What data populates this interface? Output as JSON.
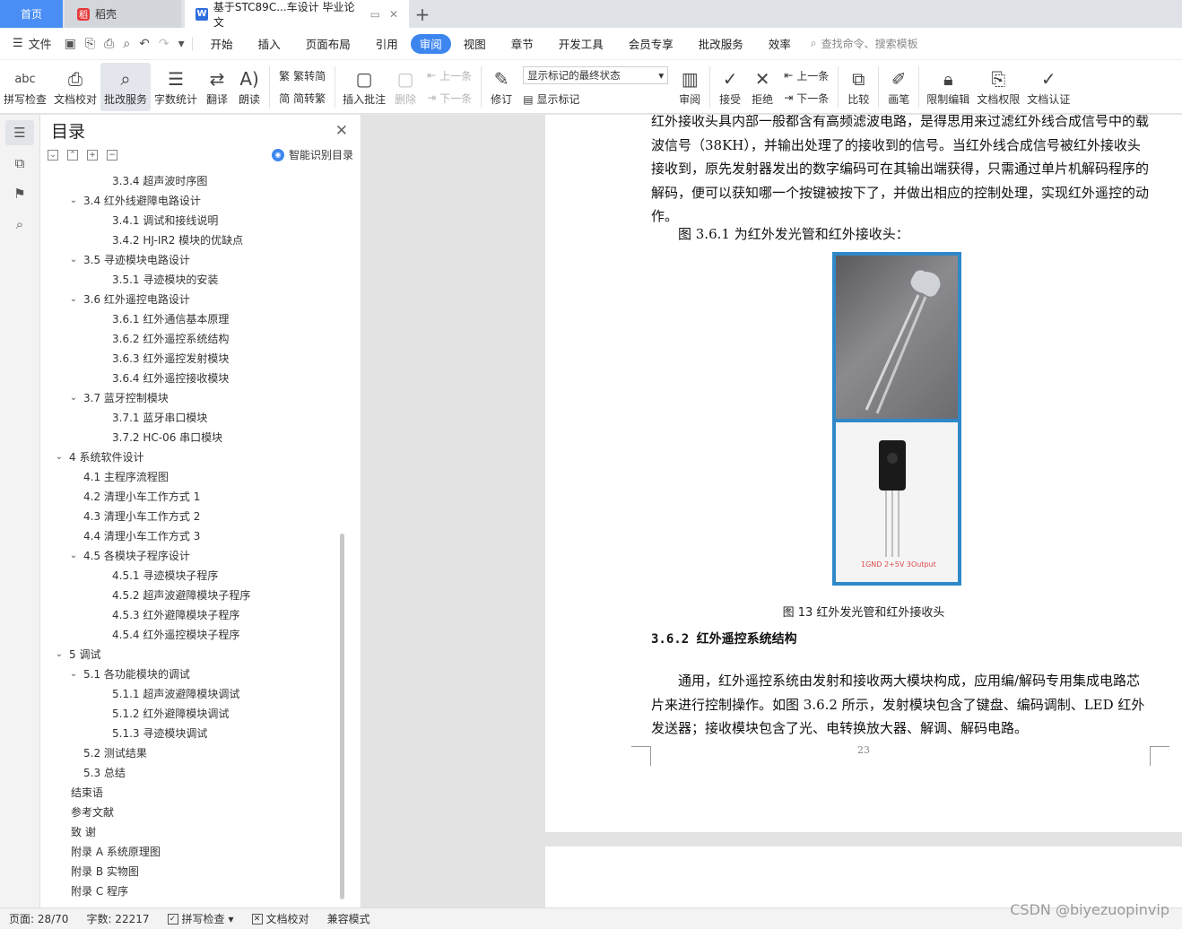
{
  "tabs": {
    "home": "首页",
    "daoke": "稻壳",
    "doc": "基于STC89C...车设计 毕业论文"
  },
  "menubar": {
    "file": "文件",
    "menus": [
      "开始",
      "插入",
      "页面布局",
      "引用",
      "审阅",
      "视图",
      "章节",
      "开发工具",
      "会员专享",
      "批改服务",
      "效率"
    ],
    "active_menu": "审阅",
    "search": "查找命令、搜索模板"
  },
  "ribbon": {
    "spell": "拼写检查",
    "proofread": "文档校对",
    "review_service": "批改服务",
    "word_count": "字数统计",
    "translate": "翻译",
    "read_aloud": "朗读",
    "trad_to_simp": "繁转简",
    "simp_to_trad": "简转繁",
    "insert_comment": "插入批注",
    "delete": "删除",
    "prev": "上一条",
    "next": "下一条",
    "revise": "修订",
    "markup_state": "显示标记的最终状态",
    "show_markup": "显示标记",
    "review": "审阅",
    "accept": "接受",
    "reject": "拒绝",
    "prev2": "上一条",
    "next2": "下一条",
    "compare": "比较",
    "pen": "画笔",
    "restrict": "限制编辑",
    "permission": "文档权限",
    "certify": "文档认证"
  },
  "toc": {
    "title": "目录",
    "smart": "智能识别目录",
    "items": [
      {
        "text": "3.3.4  超声波时序图",
        "level": 3
      },
      {
        "text": "3.4  红外线避障电路设计",
        "level": 2,
        "chev": true
      },
      {
        "text": "3.4.1  调试和接线说明",
        "level": 3
      },
      {
        "text": "3.4.2 HJ-IR2 模块的优缺点",
        "level": 3
      },
      {
        "text": "3.5  寻迹模块电路设计",
        "level": 2,
        "chev": true
      },
      {
        "text": "3.5.1  寻迹模块的安装",
        "level": 3
      },
      {
        "text": "3.6  红外遥控电路设计",
        "level": 2,
        "chev": true
      },
      {
        "text": "3.6.1  红外通信基本原理",
        "level": 3
      },
      {
        "text": "3.6.2  红外遥控系统结构",
        "level": 3
      },
      {
        "text": "3.6.3  红外遥控发射模块",
        "level": 3
      },
      {
        "text": "3.6.4  红外遥控接收模块",
        "level": 3
      },
      {
        "text": "3.7  蓝牙控制模块",
        "level": 2,
        "chev": true
      },
      {
        "text": "3.7.1  蓝牙串口模块",
        "level": 3
      },
      {
        "text": "3.7.2 HC-06 串口模块",
        "level": 3
      },
      {
        "text": "4  系统软件设计",
        "level": 1,
        "chev": true
      },
      {
        "text": "4.1  主程序流程图",
        "level": 2
      },
      {
        "text": "4.2  清理小车工作方式 1",
        "level": 2
      },
      {
        "text": "4.3  清理小车工作方式 2",
        "level": 2
      },
      {
        "text": "4.4  清理小车工作方式 3",
        "level": 2
      },
      {
        "text": "4.5  各模块子程序设计",
        "level": 2,
        "chev": true
      },
      {
        "text": "4.5.1  寻迹模块子程序",
        "level": 3
      },
      {
        "text": "4.5.2  超声波避障模块子程序",
        "level": 3
      },
      {
        "text": "4.5.3  红外避障模块子程序",
        "level": 3
      },
      {
        "text": "4.5.4  红外遥控模块子程序",
        "level": 3
      },
      {
        "text": "5  调试",
        "level": 1,
        "chev": true
      },
      {
        "text": "5.1  各功能模块的调试",
        "level": 2,
        "chev": true
      },
      {
        "text": "5.1.1  超声波避障模块调试",
        "level": 3
      },
      {
        "text": "5.1.2  红外避障模块调试",
        "level": 3
      },
      {
        "text": "5.1.3  寻迹模块调试",
        "level": 3
      },
      {
        "text": "5.2  测试结果",
        "level": 2
      },
      {
        "text": "5.3  总结",
        "level": 2
      },
      {
        "text": "结束语",
        "level": 0
      },
      {
        "text": "参考文献",
        "level": 0
      },
      {
        "text": "致    谢",
        "level": 0
      },
      {
        "text": "附录 A    系统原理图",
        "level": 0
      },
      {
        "text": "附录 B    实物图",
        "level": 0
      },
      {
        "text": "附录 C    程序",
        "level": 0
      }
    ]
  },
  "document": {
    "para1": "红外接收头具内部一般都含有高频滤波电路，是得思用来过滤红外线合成信号中的载波信号（38KH），并输出处理了的接收到的信号。当红外线合成信号被红外接收头接收到，原先发射器发出的数字编码可在其输出端获得，只需通过单片机解码程序的解码，便可以获知哪一个按键被按下了，并做出相应的控制处理，实现红外遥控的动作。",
    "fig_intro": "图 3.6.1 为红外发光管和红外接收头：",
    "photo_label": "1GND 2+5V 3Output",
    "caption": "图 13  红外发光管和红外接收头",
    "heading": "3.6.2  红外遥控系统结构",
    "para2": "通用，红外遥控系统由发射和接收两大模块构成，应用编/解码专用集成电路芯片来进行控制操作。如图 3.6.2 所示，发射模块包含了键盘、编码调制、LED 红外发送器；接收模块包含了光、电转换放大器、解调、解码电路。",
    "page_number": "23"
  },
  "status": {
    "page": "页面: 28/70",
    "words": "字数: 22217",
    "spell": "拼写检查",
    "proof": "文档校对",
    "compat": "兼容模式"
  },
  "watermark": "CSDN @biyezuopinvip"
}
